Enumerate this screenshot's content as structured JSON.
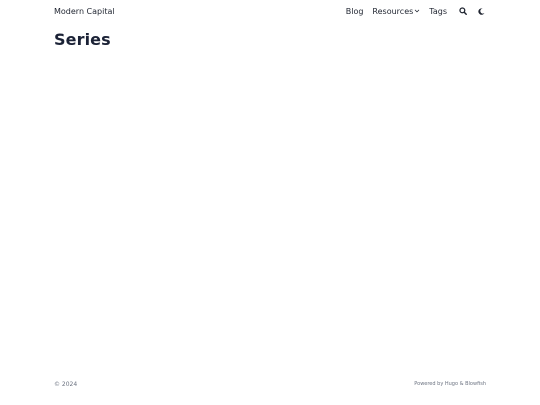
{
  "header": {
    "site_title": "Modern Capital",
    "nav": {
      "blog": "Blog",
      "resources": "Resources",
      "tags": "Tags"
    },
    "icons": {
      "search": "search-icon",
      "theme": "moon-icon",
      "dropdown": "chevron-down-icon"
    }
  },
  "main": {
    "title": "Series"
  },
  "footer": {
    "copyright": "© 2024",
    "powered_by": "Powered by Hugo & Blowfish"
  }
}
